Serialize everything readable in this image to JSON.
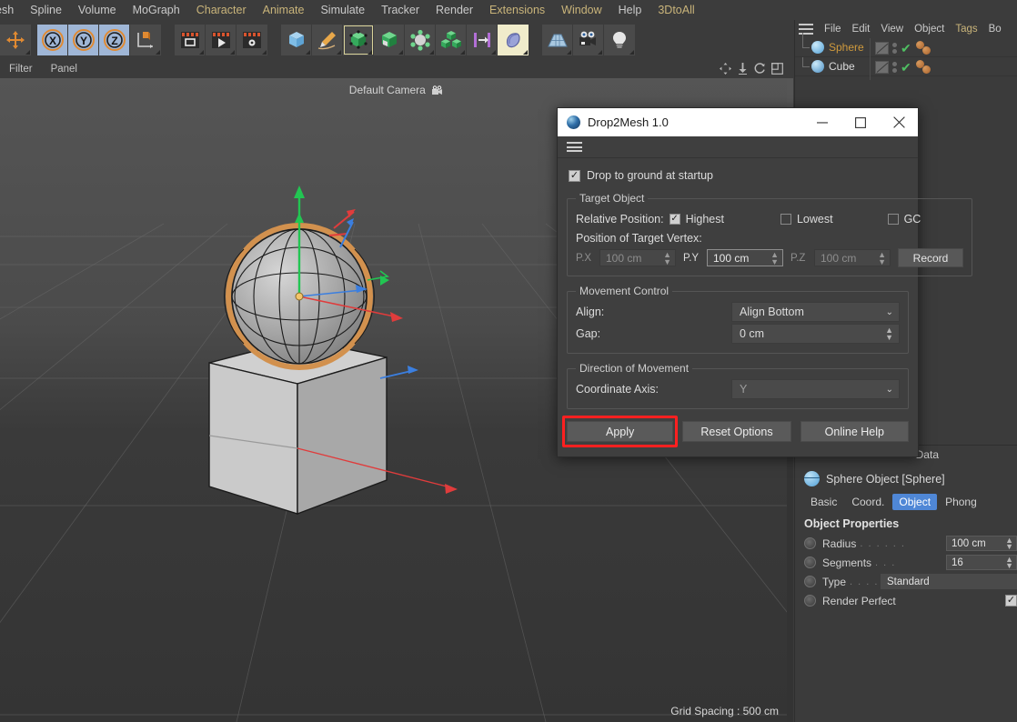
{
  "app": {
    "menubar": [
      "esh",
      "Spline",
      "Volume",
      "MoGraph",
      "Character",
      "Animate",
      "Simulate",
      "Tracker",
      "Render",
      "Extensions",
      "Window",
      "Help",
      "3DtoAll"
    ],
    "menubar_accent": [
      "Character",
      "Animate",
      "Extensions",
      "Window",
      "3DtoAll"
    ],
    "toolbar_icons": [
      "move-tool-icon",
      "axis-x-icon",
      "axis-y-icon",
      "axis-z-icon",
      "object-axis-icon",
      "render-view-icon",
      "render-picture-viewer-icon",
      "render-settings-icon",
      "cube-primitive-icon",
      "spline-pen-icon",
      "nurbs-generator-icon",
      "array-modeling-icon",
      "deformer-icon",
      "mograph-cloner-icon",
      "mospline-icon",
      "scene-nodes-icon",
      "floor-environment-icon",
      "camera-icon",
      "light-icon"
    ]
  },
  "viewport": {
    "filter_label": "Filter",
    "panel_label": "Panel",
    "camera_label": "Default Camera",
    "camera_icon": "camera-icon",
    "grid_spacing": "Grid Spacing : 500 cm"
  },
  "object_manager": {
    "menu": [
      "File",
      "Edit",
      "View",
      "Object",
      "Tags",
      "Bo"
    ],
    "menu_accent": [
      "Tags"
    ],
    "hamburger_icon": "hamburger-menu-icon",
    "rows": [
      {
        "name": "Sphere",
        "icon": "sphere-object-icon",
        "color": "#cf9a3d",
        "selected": true
      },
      {
        "name": "Cube",
        "icon": "cube-object-icon",
        "color": "#d6d6d6",
        "selected": false
      }
    ]
  },
  "attribute_manager": {
    "tab_clipped": "Data",
    "object_title": "Sphere Object [Sphere]",
    "object_icon": "sphere-object-icon",
    "tabs": [
      {
        "label": "Basic",
        "active": false
      },
      {
        "label": "Coord.",
        "active": false
      },
      {
        "label": "Object",
        "active": true
      },
      {
        "label": "Phong",
        "active": false
      }
    ],
    "section_title": "Object Properties",
    "properties": [
      {
        "label": "Radius",
        "dots": ". . . . . .",
        "value": "100 cm",
        "kind": "number"
      },
      {
        "label": "Segments",
        "dots": ". . .",
        "value": "16",
        "kind": "number"
      },
      {
        "label": "Type",
        "dots": ". . . . . .",
        "value": "Standard",
        "kind": "flat"
      },
      {
        "label": "Render Perfect",
        "dots": "",
        "value": "✓",
        "kind": "checkbox",
        "checked": true
      }
    ]
  },
  "dialog": {
    "title": "Drop2Mesh 1.0",
    "app_icon": "drop2mesh-app-icon",
    "window_buttons": [
      {
        "name": "minimize-button",
        "glyph": "—"
      },
      {
        "name": "maximize-button",
        "glyph": "▢"
      },
      {
        "name": "close-button",
        "glyph": "✕"
      }
    ],
    "hamburger_icon": "hamburger-menu-icon",
    "startup_checkbox": {
      "label": "Drop to ground at startup",
      "checked": true,
      "glyph": "✓"
    },
    "target_object": {
      "legend": "Target Object",
      "relative_position_label": "Relative Position:",
      "options": [
        {
          "label": "Highest",
          "checked": true,
          "glyph": "✓"
        },
        {
          "label": "Lowest",
          "checked": false,
          "glyph": ""
        },
        {
          "label": "GC",
          "checked": false,
          "glyph": ""
        }
      ],
      "vertex_label": "Position of Target Vertex:",
      "fields": [
        {
          "label": "P.X",
          "value": "100 cm",
          "enabled": false
        },
        {
          "label": "P.Y",
          "value": "100 cm",
          "enabled": true
        },
        {
          "label": "P.Z",
          "value": "100 cm",
          "enabled": false
        }
      ],
      "record_button": "Record"
    },
    "movement_control": {
      "legend": "Movement Control",
      "align_label": "Align:",
      "align_value": "Align Bottom",
      "gap_label": "Gap:",
      "gap_value": "0 cm"
    },
    "direction_of_movement": {
      "legend": "Direction of Movement",
      "axis_label": "Coordinate Axis:",
      "axis_value": "Y"
    },
    "buttons": [
      {
        "name": "apply-button",
        "label": "Apply",
        "highlighted": true
      },
      {
        "name": "reset-options-button",
        "label": "Reset Options",
        "highlighted": false
      },
      {
        "name": "online-help-button",
        "label": "Online Help",
        "highlighted": false
      }
    ]
  },
  "colors": {
    "highlight_red": "#ff2020",
    "tab_active_blue": "#4f87d6",
    "accent_yellow": "#c9b47a",
    "selected_object_orange": "#cf9a3d"
  }
}
